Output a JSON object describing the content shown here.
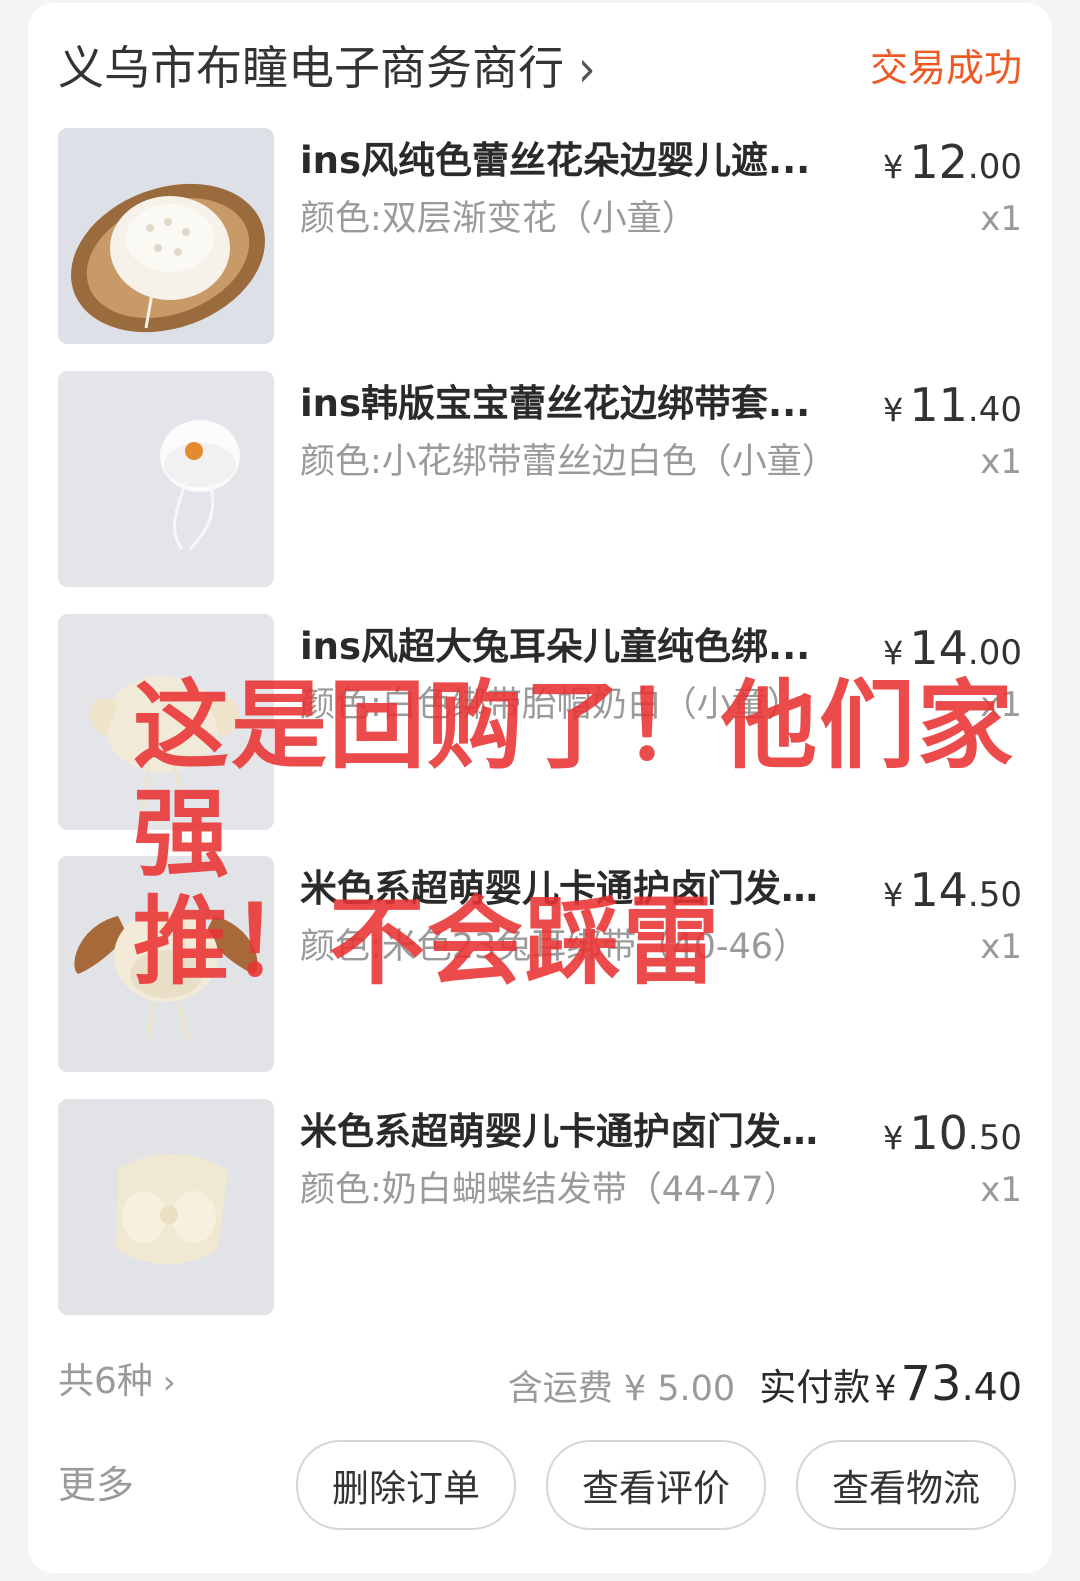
{
  "shop": {
    "name": "义乌市布瞳电子商务商行",
    "chevron_icon": "chevron-right-icon",
    "status": "交易成功",
    "status_color": "#ef5a24"
  },
  "items": [
    {
      "title": "ins风纯色蕾丝花朵边婴儿遮...",
      "variant": "颜色:双层渐变花（小童）",
      "currency": "¥",
      "price_int": "12",
      "price_dec": ".00",
      "qty": "x1",
      "image": "lace-bonnet-basket"
    },
    {
      "title": "ins韩版宝宝蕾丝花边绑带套...",
      "variant": "颜色:小花绑带蕾丝边白色（小童）",
      "currency": "¥",
      "price_int": "11",
      "price_dec": ".40",
      "qty": "x1",
      "image": "white-lace-bonnet"
    },
    {
      "title": "ins风超大兔耳朵儿童纯色绑...",
      "variant": "颜色:白色绑带胎帽奶白（小童）",
      "currency": "¥",
      "price_int": "14",
      "price_dec": ".00",
      "qty": "x1",
      "image": "bunny-ear-hat"
    },
    {
      "title": "米色系超萌婴儿卡通护卤门发...",
      "variant": "颜色:米色23兔耳绑带（40-46）",
      "currency": "¥",
      "price_int": "14",
      "price_dec": ".50",
      "qty": "x1",
      "image": "beige-ear-bonnet"
    },
    {
      "title": "米色系超萌婴儿卡通护卤门发...",
      "variant": "颜色:奶白蝴蝶结发带（44-47）",
      "currency": "¥",
      "price_int": "10",
      "price_dec": ".50",
      "qty": "x1",
      "image": "cream-bow-headband"
    }
  ],
  "summary": {
    "kinds": "共6种",
    "shipping": "含运费 ¥ 5.00",
    "paid_label": "实付款",
    "paid_currency": "¥",
    "paid_int": "73",
    "paid_dec": ".40"
  },
  "actions": {
    "more": "更多",
    "delete": "删除订单",
    "review": "查看评价",
    "logistics": "查看物流"
  },
  "overlay_text": {
    "line1": "这是回购了！他们家强",
    "line2": "推！不会踩雷",
    "color": "#e93232"
  }
}
